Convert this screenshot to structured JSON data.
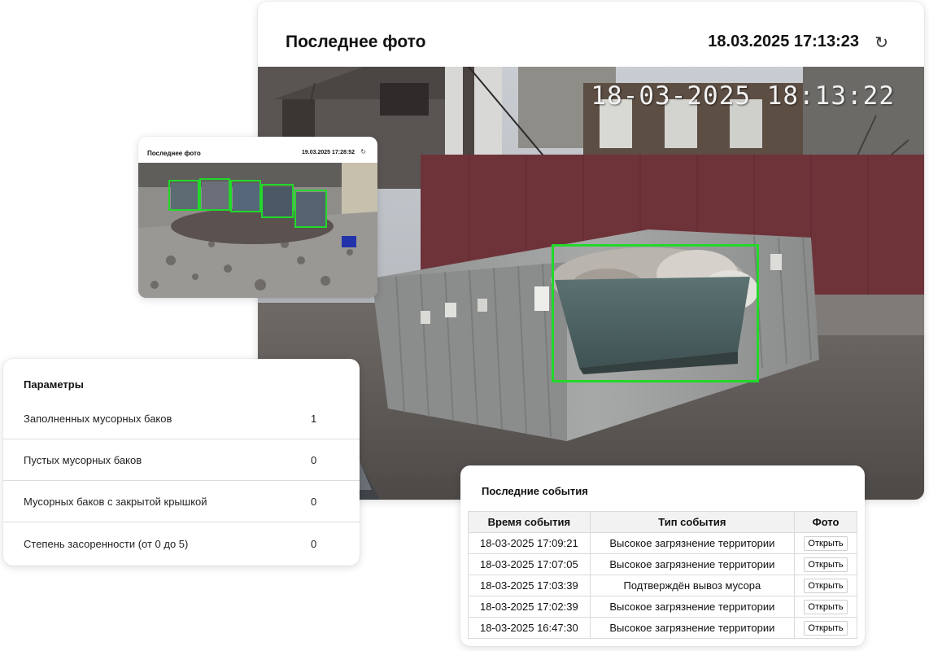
{
  "main_photo": {
    "title": "Последнее фото",
    "timestamp": "18.03.2025 17:13:23",
    "refresh_glyph": "↻",
    "overlay_timestamp": "18-03-2025 18:13:22",
    "detection_color": "#22d82a"
  },
  "small_photo": {
    "title": "Последнее фото",
    "timestamp": "19.03.2025 17:28:52",
    "refresh_glyph": "↻"
  },
  "parameters": {
    "title": "Параметры",
    "rows": [
      {
        "label": "Заполненных мусорных баков",
        "value": "1"
      },
      {
        "label": "Пустых мусорных баков",
        "value": "0"
      },
      {
        "label": "Мусорных баков с закрытой крышкой",
        "value": "0"
      },
      {
        "label": "Степень засоренности (от 0 до 5)",
        "value": "0"
      }
    ]
  },
  "events": {
    "title": "Последние события",
    "columns": [
      "Время события",
      "Тип события",
      "Фото"
    ],
    "open_label": "Открыть",
    "rows": [
      {
        "time": "18-03-2025 17:09:21",
        "type": "Высокое загрязнение территории"
      },
      {
        "time": "18-03-2025 17:07:05",
        "type": "Высокое загрязнение территории"
      },
      {
        "time": "18-03-2025 17:03:39",
        "type": "Подтверждён вывоз мусора"
      },
      {
        "time": "18-03-2025 17:02:39",
        "type": "Высокое загрязнение территории"
      },
      {
        "time": "18-03-2025 16:47:30",
        "type": "Высокое загрязнение территории"
      }
    ]
  }
}
